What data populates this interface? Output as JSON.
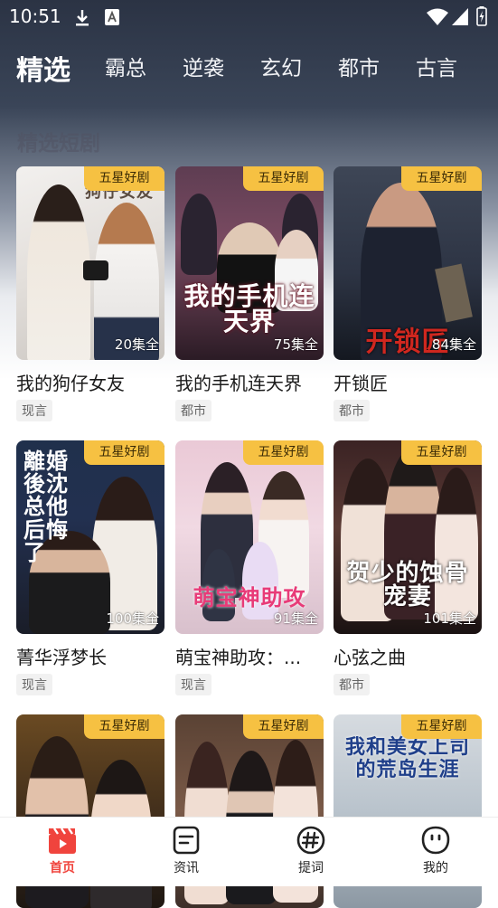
{
  "status_bar": {
    "time": "10:51"
  },
  "tabs": [
    {
      "label": "精选",
      "active": true
    },
    {
      "label": "霸总"
    },
    {
      "label": "逆袭"
    },
    {
      "label": "玄幻"
    },
    {
      "label": "都市"
    },
    {
      "label": "古言"
    }
  ],
  "section": {
    "title": "精选短剧"
  },
  "badge_text": "五星好剧",
  "cards": [
    {
      "title": "我的狗仔女友",
      "episodes": "20集全",
      "genre": "现言",
      "art_title": "狗仔女友"
    },
    {
      "title": "我的手机连天界",
      "episodes": "75集全",
      "genre": "都市",
      "art_title": "我的手机连天界"
    },
    {
      "title": "开锁匠",
      "episodes": "84集全",
      "genre": "都市",
      "art_title": "开锁匠"
    },
    {
      "title": "菁华浮梦长",
      "episodes": "100集全",
      "genre": "现言",
      "art_title": "離婚後沈总他后悔了"
    },
    {
      "title": "萌宝神助攻：...",
      "episodes": "91集全",
      "genre": "现言",
      "art_title": "萌宝神助攻"
    },
    {
      "title": "心弦之曲",
      "episodes": "101集全",
      "genre": "都市",
      "art_title": "贺少的蚀骨宠妻"
    },
    {
      "title": "",
      "episodes": "",
      "genre": "",
      "art_title": ""
    },
    {
      "title": "",
      "episodes": "",
      "genre": "",
      "art_title": ""
    },
    {
      "title": "",
      "episodes": "",
      "genre": "",
      "art_title": "我和美女上司的荒岛生涯"
    }
  ],
  "bottom_nav": [
    {
      "label": "首页",
      "icon": "clapperboard-icon",
      "active": true
    },
    {
      "label": "资讯",
      "icon": "document-icon"
    },
    {
      "label": "提词",
      "icon": "hashtag-icon"
    },
    {
      "label": "我的",
      "icon": "smiley-face-icon"
    }
  ],
  "colors": {
    "accent": "#f0443d",
    "badge": "#f6c142"
  }
}
